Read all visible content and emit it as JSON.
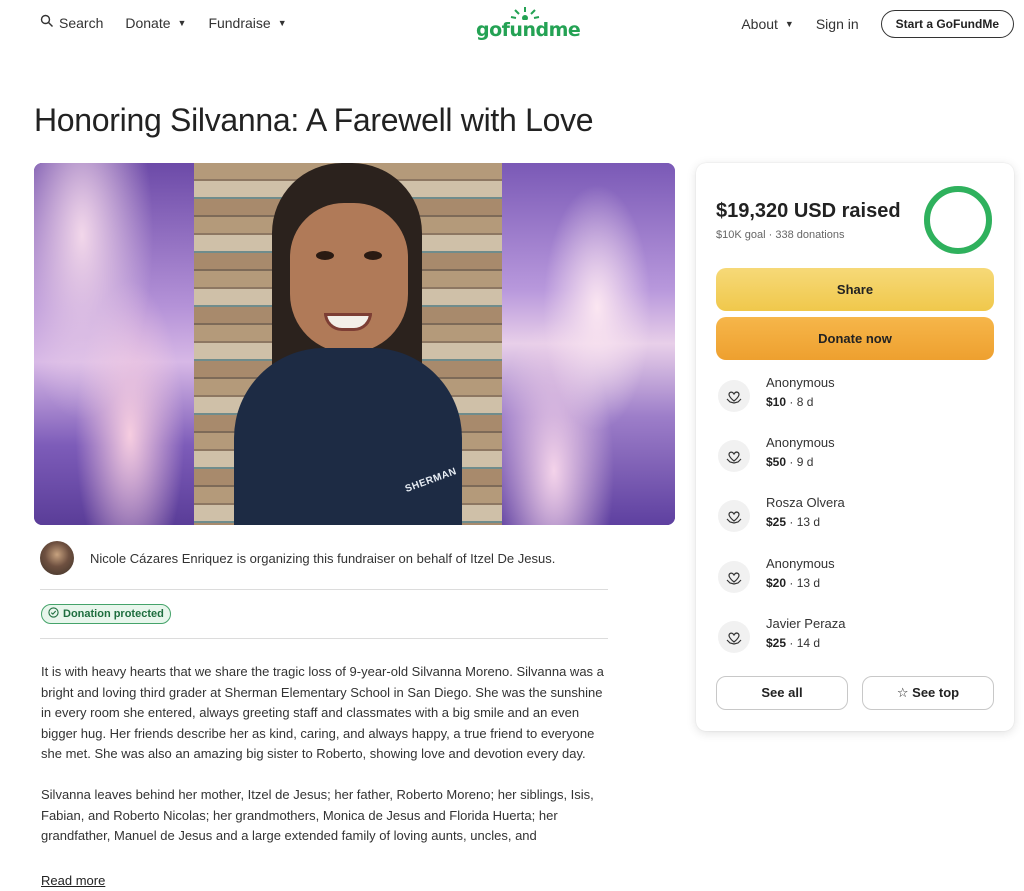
{
  "header": {
    "search_label": "Search",
    "donate_label": "Donate",
    "fundraise_label": "Fundraise",
    "logo_text": "gofundme",
    "about_label": "About",
    "signin_label": "Sign in",
    "start_label": "Start a GoFundMe"
  },
  "campaign": {
    "title": "Honoring Silvanna: A Farewell with Love",
    "organizer_text": "Nicole Cázares Enriquez is organizing this fundraiser on behalf of Itzel De Jesus.",
    "badge_label": "Donation protected",
    "story_paragraph_1": "It is with heavy hearts that we share the tragic loss of 9-year-old Silvanna Moreno. Silvanna was a bright and loving third grader at Sherman Elementary School in San Diego. She was the sunshine in every room she entered, always greeting staff and classmates with a big smile and an even bigger hug. Her friends describe her as kind, caring, and always happy, a true friend to everyone she met. She was also an amazing big sister to Roberto, showing love and devotion every day.",
    "story_paragraph_2": "Silvanna leaves behind her mother, Itzel de Jesus; her father, Roberto Moreno; her siblings, Isis, Fabian, and Roberto Nicolas; her grandmothers, Monica de Jesus and Florida Huerta; her grandfather, Manuel de Jesus and a large extended family of loving aunts, uncles, and",
    "read_more_label": "Read more",
    "jacket_text": "SHERMAN"
  },
  "panel": {
    "raised_label": "$19,320 USD raised",
    "goal_label": "$10K goal",
    "donations_label": "338 donations",
    "progress_fraction": 1.0,
    "share_label": "Share",
    "donate_label": "Donate now",
    "see_all_label": "See all",
    "see_top_label": "See top",
    "donors": [
      {
        "name": "Anonymous",
        "amount": "$10",
        "time": "8 d"
      },
      {
        "name": "Anonymous",
        "amount": "$50",
        "time": "9 d"
      },
      {
        "name": "Rosza Olvera",
        "amount": "$25",
        "time": "13 d"
      },
      {
        "name": "Anonymous",
        "amount": "$20",
        "time": "13 d"
      },
      {
        "name": "Javier Peraza",
        "amount": "$25",
        "time": "14 d"
      }
    ]
  },
  "colors": {
    "brand_green": "#24a254",
    "share_yellow": "#f0c84b",
    "donate_orange": "#eea02f"
  },
  "icons": [
    "search-icon",
    "chevron-down-icon",
    "shield-check-icon",
    "heart-hands-icon",
    "star-icon"
  ]
}
